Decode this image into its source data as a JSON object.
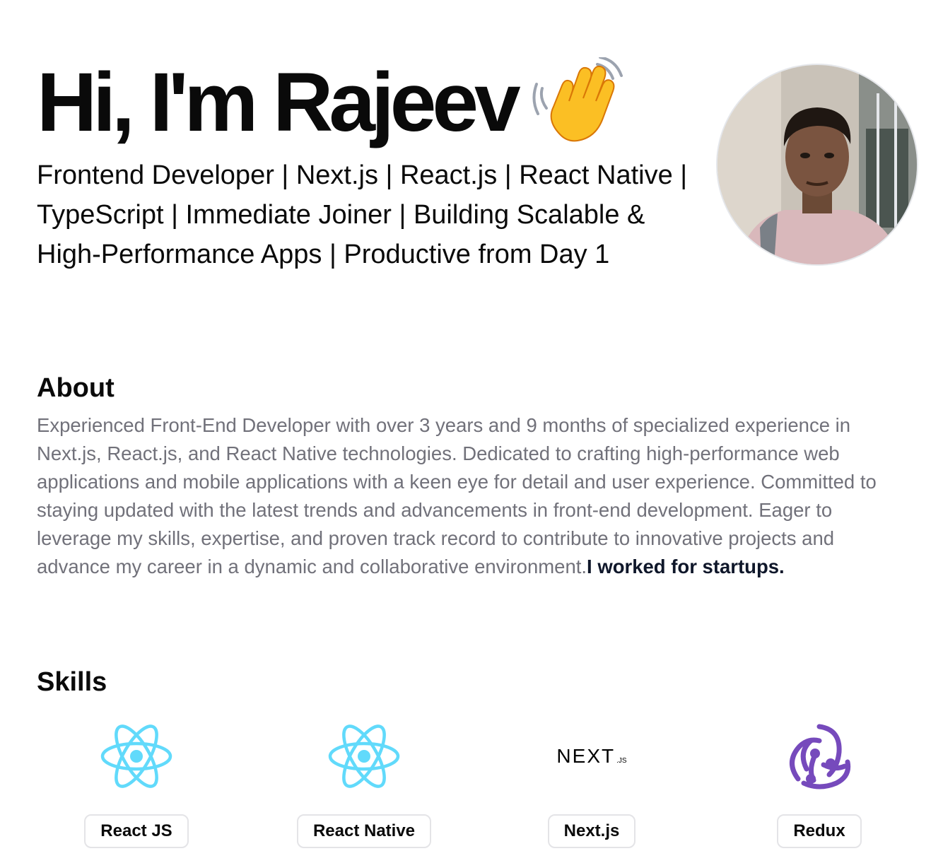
{
  "hero": {
    "title": "Hi, I'm Rajeev",
    "wave_icon": "waving-hand-emoji",
    "subtitle": "Frontend Developer | Next.js | React.js | React Native | TypeScript | Immediate Joiner | Building Scalable & High-Performance Apps | Productive from Day 1"
  },
  "about": {
    "heading": "About",
    "text": "Experienced Front-End Developer with over 3 years and 9 months of specialized experience in Next.js, React.js, and React Native technologies. Dedicated to crafting high-performance web applications and mobile applications with a keen eye for detail and user experience. Committed to staying updated with the latest trends and advancements in front-end development. Eager to leverage my skills, expertise, and proven track record to contribute to innovative projects and advance my career in a dynamic and collaborative environment.",
    "highlight": "I worked for startups."
  },
  "skills": {
    "heading": "Skills",
    "items": [
      {
        "label": "React JS",
        "icon": "react-icon"
      },
      {
        "label": "React Native",
        "icon": "react-icon"
      },
      {
        "label": "Next.js",
        "icon": "nextjs-icon",
        "logo_text": "NEXT",
        "logo_suffix": ".JS"
      },
      {
        "label": "Redux",
        "icon": "redux-icon"
      }
    ]
  },
  "colors": {
    "react": "#61dafb",
    "redux": "#764abc",
    "muted_text": "#71717a"
  }
}
